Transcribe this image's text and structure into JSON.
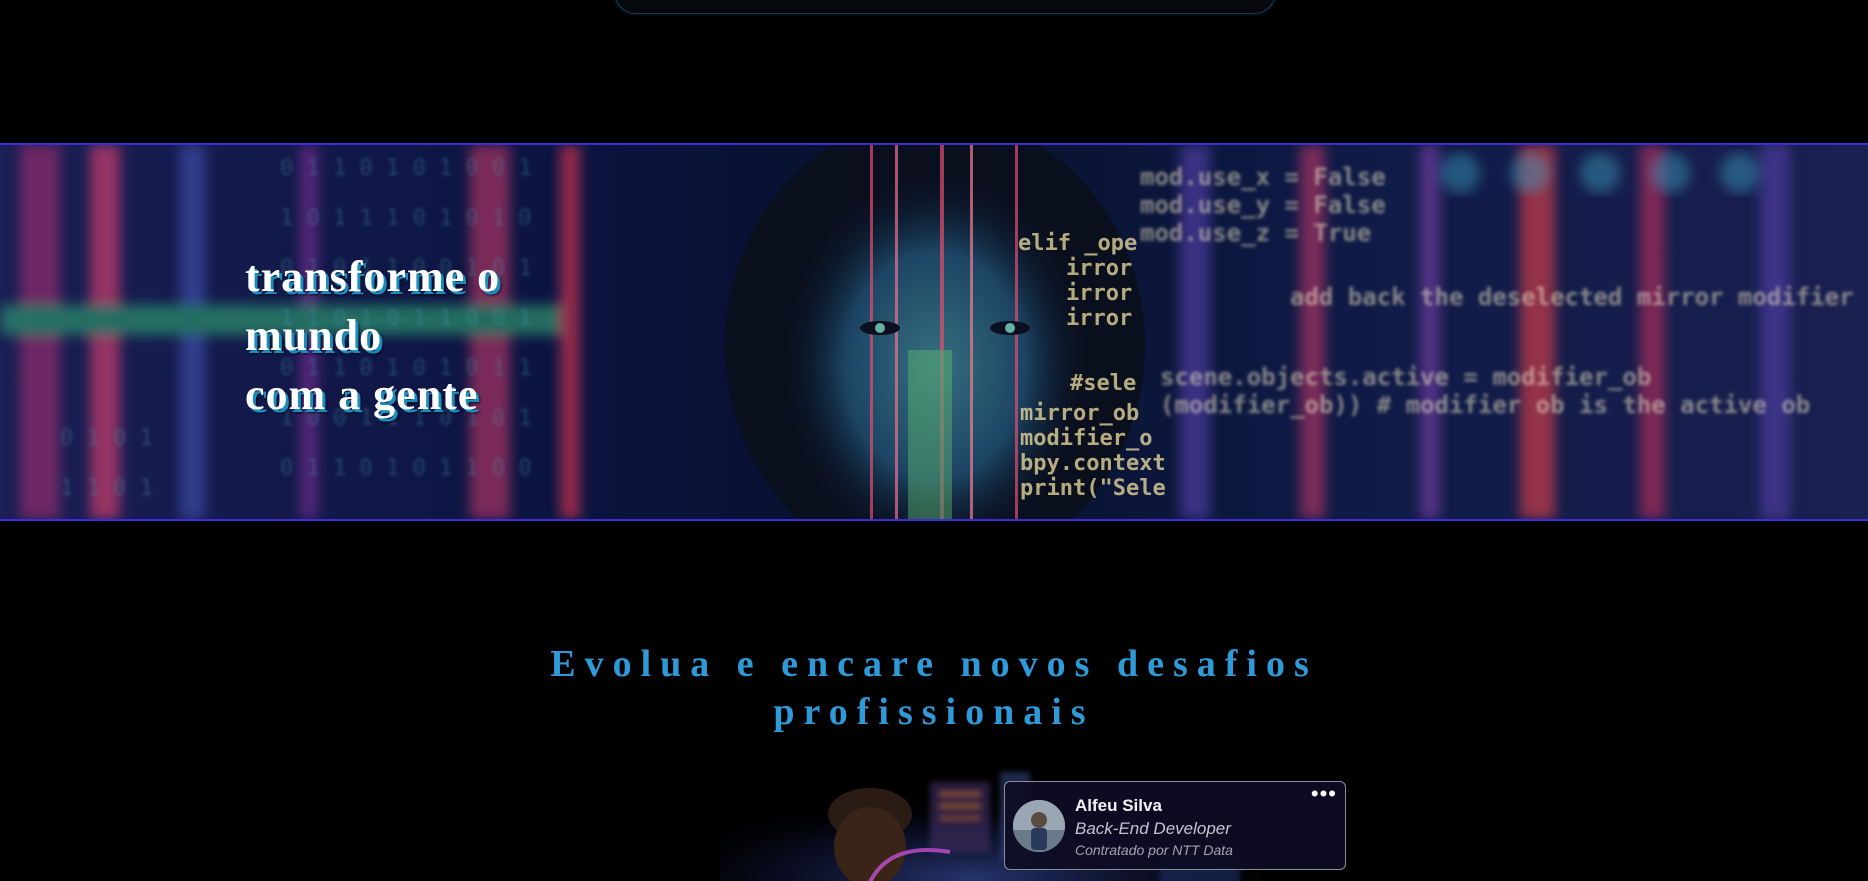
{
  "hero": {
    "title_lines": [
      "transforme o",
      "mundo",
      "com a gente"
    ]
  },
  "section": {
    "title_lines": [
      "Evolua e encare novos desafios",
      "profissionais"
    ]
  },
  "profile_card": {
    "name": "Alfeu Silva",
    "role": "Back-End Developer",
    "company": "Contratado por NTT Data",
    "more_label": "•••"
  },
  "colors": {
    "accent_blue": "#2e9ad8",
    "hero_border": "#3a2bd6",
    "background": "#000000"
  }
}
